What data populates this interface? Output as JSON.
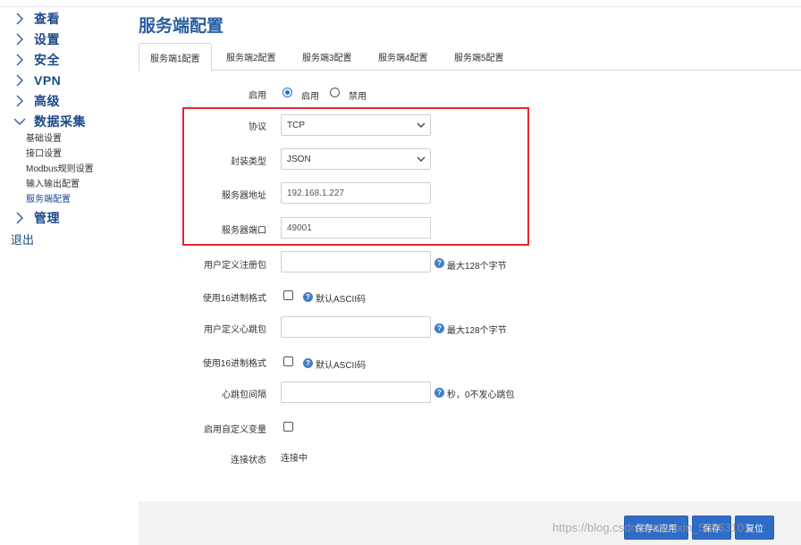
{
  "sidebar": {
    "items": [
      {
        "label": "查看"
      },
      {
        "label": "设置"
      },
      {
        "label": "安全"
      },
      {
        "label": "VPN"
      },
      {
        "label": "高级"
      },
      {
        "label": "数据采集"
      },
      {
        "label": "管理"
      }
    ],
    "sub_items": [
      {
        "label": "基础设置"
      },
      {
        "label": "接口设置"
      },
      {
        "label": "Modbus规则设置"
      },
      {
        "label": "输入输出配置"
      },
      {
        "label": "服务端配置"
      }
    ],
    "logout_label": "退出"
  },
  "page": {
    "title": "服务端配置"
  },
  "tabs": [
    {
      "label": "服务端1配置"
    },
    {
      "label": "服务端2配置"
    },
    {
      "label": "服务端3配置"
    },
    {
      "label": "服务端4配置"
    },
    {
      "label": "服务端5配置"
    }
  ],
  "form": {
    "enable": {
      "label": "启用",
      "option_on": "启用",
      "option_off": "禁用",
      "selected": "启用"
    },
    "protocol": {
      "label": "协议",
      "value": "TCP"
    },
    "encapsulation": {
      "label": "封装类型",
      "value": "JSON"
    },
    "server_address": {
      "label": "服务器地址",
      "value": "192.168.1.227"
    },
    "server_port": {
      "label": "服务器端口",
      "value": "49001"
    },
    "register_packet": {
      "label": "用户定义注册包",
      "value": "",
      "help": "最大128个字节"
    },
    "hex_format_1": {
      "label": "使用16进制格式",
      "help": "默认ASCII码"
    },
    "heartbeat_packet": {
      "label": "用户定义心跳包",
      "value": "",
      "help": "最大128个字节"
    },
    "hex_format_2": {
      "label": "使用16进制格式",
      "help": "默认ASCII码"
    },
    "heartbeat_interval": {
      "label": "心跳包间隔",
      "value": "",
      "help": "秒，0不发心跳包"
    },
    "custom_vars": {
      "label": "启用自定义变量"
    },
    "connection_status": {
      "label": "连接状态",
      "value": "连接中"
    }
  },
  "buttons": {
    "save_apply": "保存&应用",
    "save": "保存",
    "reset": "复位"
  },
  "help_icon_glyph": "?",
  "watermark": "https://blog.csdn.net/weixin_50563101",
  "colors": {
    "accent": "#2f6cc7",
    "title": "#2a5d9f",
    "highlight_border": "#e0282e"
  }
}
